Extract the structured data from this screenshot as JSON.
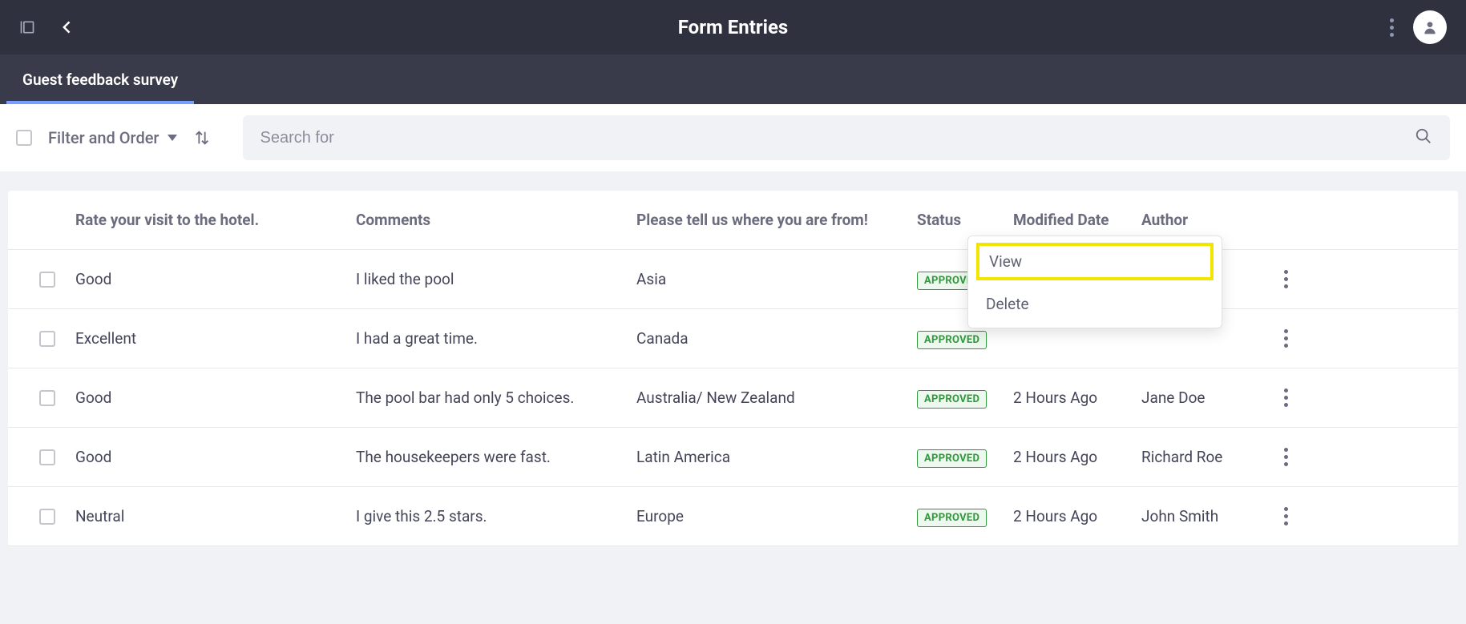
{
  "header": {
    "title": "Form Entries"
  },
  "tabs": {
    "active": "Guest feedback survey"
  },
  "toolbar": {
    "filter_label": "Filter and Order",
    "search_placeholder": "Search for"
  },
  "table": {
    "columns": {
      "rating": "Rate your visit to the hotel.",
      "comments": "Comments",
      "location": "Please tell us where you are from!",
      "status": "Status",
      "modified": "Modified Date",
      "author": "Author"
    },
    "rows": [
      {
        "rating": "Good",
        "comments": "I liked the pool",
        "location": "Asia",
        "status": "APPROVED",
        "modified": "",
        "author": ""
      },
      {
        "rating": "Excellent",
        "comments": "I had a great time.",
        "location": "Canada",
        "status": "APPROVED",
        "modified": "",
        "author": ""
      },
      {
        "rating": "Good",
        "comments": "The pool bar had only 5 choices.",
        "location": "Australia/ New Zealand",
        "status": "APPROVED",
        "modified": "2 Hours Ago",
        "author": "Jane Doe"
      },
      {
        "rating": "Good",
        "comments": "The housekeepers were fast.",
        "location": "Latin America",
        "status": "APPROVED",
        "modified": "2 Hours Ago",
        "author": "Richard Roe"
      },
      {
        "rating": "Neutral",
        "comments": "I give this 2.5 stars.",
        "location": "Europe",
        "status": "APPROVED",
        "modified": "2 Hours Ago",
        "author": "John Smith"
      }
    ]
  },
  "popup": {
    "view": "View",
    "delete": "Delete"
  }
}
